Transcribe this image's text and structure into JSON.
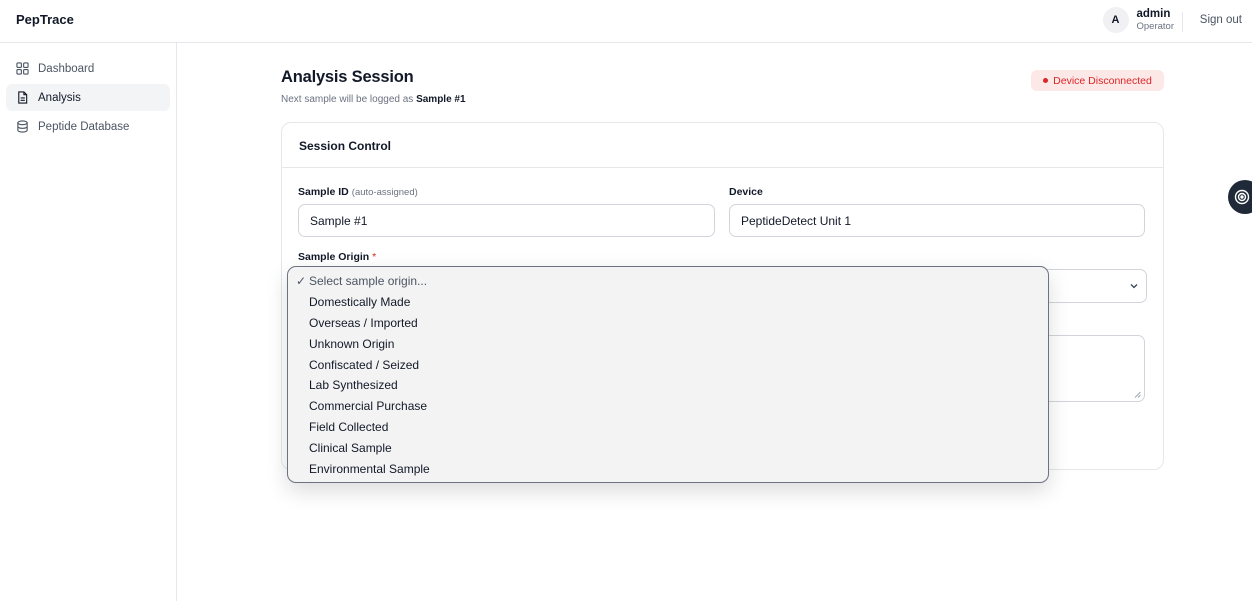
{
  "app": {
    "brand": "PepTrace"
  },
  "user": {
    "initial": "A",
    "name": "admin",
    "role": "Operator",
    "signout": "Sign out"
  },
  "sidebar": {
    "items": [
      {
        "label": "Dashboard",
        "icon": "grid-icon",
        "active": false
      },
      {
        "label": "Analysis",
        "icon": "document-icon",
        "active": true
      },
      {
        "label": "Peptide Database",
        "icon": "database-icon",
        "active": false
      }
    ]
  },
  "page": {
    "title": "Analysis Session",
    "subtitle_prefix": "Next sample will be logged as",
    "subtitle_sample": "Sample #1",
    "status": "Device Disconnected"
  },
  "session": {
    "card_title": "Session Control",
    "sample_id_label": "Sample ID",
    "sample_id_hint": "(auto-assigned)",
    "sample_id_value": "Sample #1",
    "device_label": "Device",
    "device_value": "PeptideDetect Unit 1",
    "origin_label": "Sample Origin",
    "origin_required": "*"
  },
  "origin_dropdown": {
    "selected": "Select sample origin...",
    "options": [
      "Domestically Made",
      "Overseas / Imported",
      "Unknown Origin",
      "Confiscated / Seized",
      "Lab Synthesized",
      "Commercial Purchase",
      "Field Collected",
      "Clinical Sample",
      "Environmental Sample"
    ]
  },
  "colors": {
    "danger": "#dc2626",
    "danger_bg": "#fde8e8",
    "border": "#e5e7eb"
  }
}
